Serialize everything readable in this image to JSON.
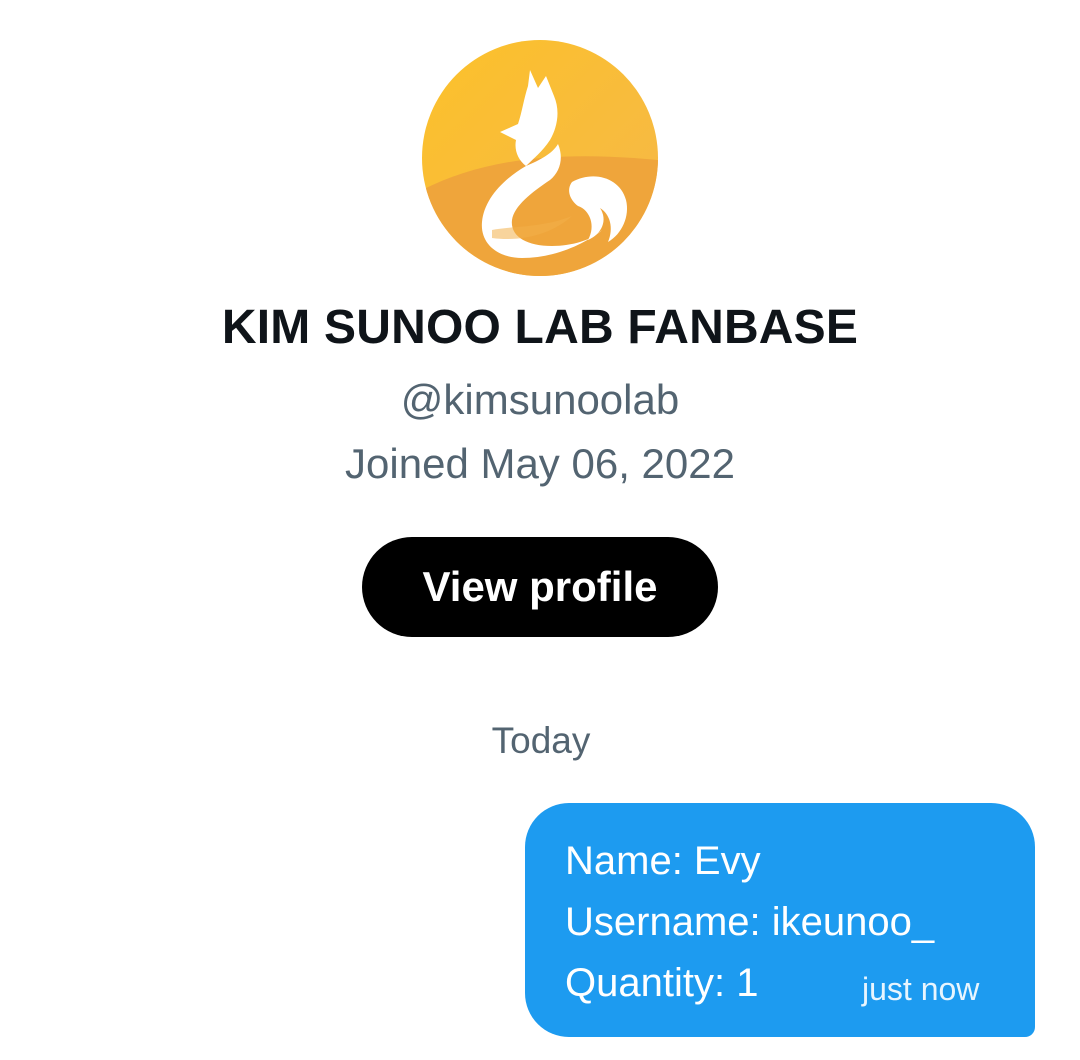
{
  "profile": {
    "avatar_icon": "fox-logo-icon",
    "avatar_colors": {
      "background_top": "#fbbd2e",
      "background_bottom": "#f0a23c",
      "figure": "#ffffff"
    },
    "name": "KIM SUNOO LAB FANBASE",
    "handle": "@kimsunoolab",
    "joined": "Joined May 06, 2022",
    "view_profile_label": "View profile"
  },
  "conversation": {
    "date_separator": "Today",
    "messages": [
      {
        "direction": "sent",
        "lines": [
          "Name: Evy",
          "Username: ikeunoo_",
          "Quantity: 1"
        ],
        "timestamp": "just now",
        "bubble_color": "#1d9bf0"
      }
    ]
  }
}
